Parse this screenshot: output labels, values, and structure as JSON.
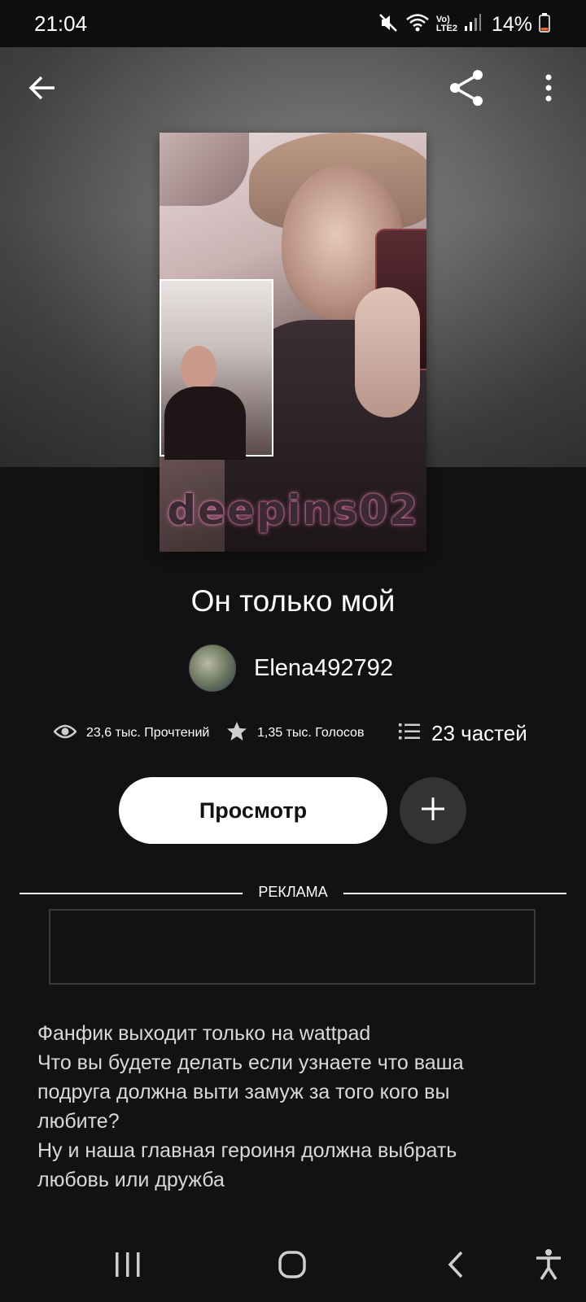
{
  "status_bar": {
    "time": "21:04",
    "battery": "14%",
    "network_label": "LTE2",
    "volte_label": "Vo)"
  },
  "story": {
    "title": "Он только мой",
    "author": "Elena492792",
    "cover_watermark": "deepins02"
  },
  "stats": {
    "reads": "23,6 тыс. Прочтений",
    "votes": "1,35 тыс. Голосов",
    "parts": "23 частей"
  },
  "actions": {
    "read_label": "Просмотр"
  },
  "ad": {
    "label": "РЕКЛАМА"
  },
  "description": [
    "Фанфик выходит только на wattpad",
    "Что вы будете делать если узнаете что ваша",
    "подруга должна выти замуж за того кого вы",
    "любите?",
    "Ну и наша главная героиня должна выбрать",
    "любовь или дружба"
  ],
  "colors": {
    "background": "#121214",
    "button_bg": "#ffffff",
    "add_button_bg": "#333336",
    "battery_low": "#e8632a"
  },
  "icons": {
    "back": "back-arrow-icon",
    "share": "share-icon",
    "more": "more-vertical-icon",
    "reads": "eye-icon",
    "votes": "star-icon",
    "parts": "list-icon",
    "add": "plus-icon",
    "nav_recents": "recents-icon",
    "nav_home": "home-icon",
    "nav_back": "nav-back-icon",
    "accessibility": "accessibility-icon"
  }
}
